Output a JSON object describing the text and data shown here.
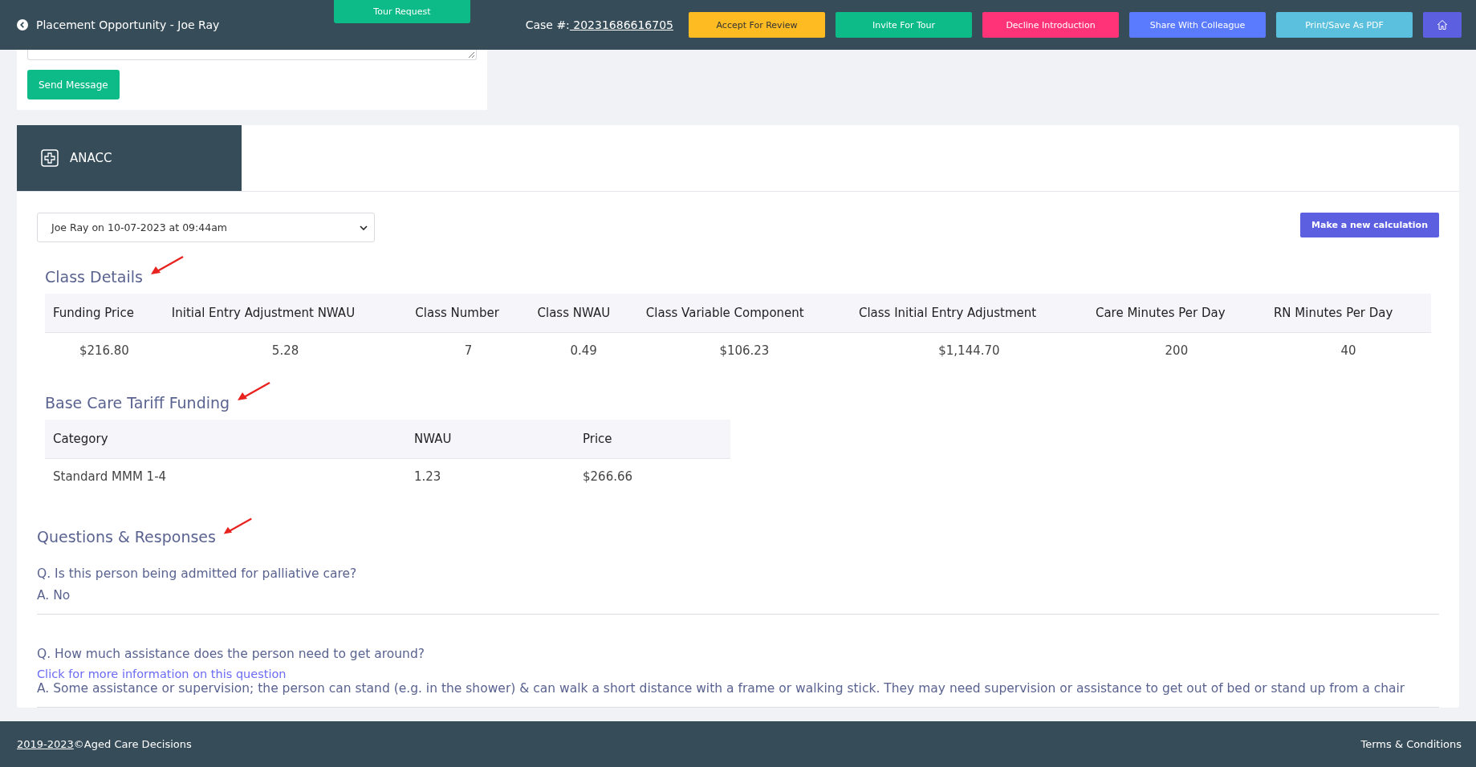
{
  "header": {
    "title": "Placement Opportunity - Joe Ray",
    "tour_request": "Tour Request",
    "case_label": "Case #:",
    "case_number": " 20231686616705",
    "actions": [
      {
        "label": "Accept For Review",
        "kind": "warning"
      },
      {
        "label": "Invite For Tour",
        "kind": "success"
      },
      {
        "label": "Decline Introduction",
        "kind": "danger"
      },
      {
        "label": "Share With Colleague",
        "kind": "primary"
      },
      {
        "label": "Print/Save As PDF",
        "kind": "info"
      },
      {
        "kind": "home"
      }
    ]
  },
  "message": {
    "send_button": "Send Message"
  },
  "anacc": {
    "tab": "ANACC",
    "assessment_select": "Joe Ray on 10-07-2023 at 09:44am",
    "new_calc_button": "Make a new calculation",
    "class_details": {
      "title": "Class Details",
      "marked": true,
      "columns": [
        "Funding Price",
        "Initial Entry Adjustment NWAU",
        "Class Number",
        "Class NWAU",
        "Class Variable Component",
        "Class Initial Entry Adjustment",
        "Care Minutes Per Day",
        "RN Minutes Per Day"
      ],
      "rows": [
        [
          "$216.80",
          "5.28",
          "7",
          "0.49",
          "$106.23",
          "$1,144.70",
          "200",
          "40"
        ]
      ]
    },
    "base_care": {
      "title": "Base Care Tariff Funding",
      "marked": true,
      "columns": [
        "Category",
        "NWAU",
        "Price"
      ],
      "rows": [
        [
          "Standard MMM 1-4",
          "1.23",
          "$266.66"
        ]
      ]
    },
    "questions": {
      "title": "Questions & Responses",
      "marked": true,
      "items": [
        {
          "question": "Q. Is this person being admitted for palliative care?",
          "answer": "A. No"
        },
        {
          "question": "Q. How much assistance does the person need to get around?",
          "info_link": "Click for more information on this question",
          "answer": "A. Some assistance or supervision; the person can stand (e.g. in the shower) & can walk a short distance with a frame or walking stick. They may need supervision or assistance to get out of bed or stand up from a chair"
        }
      ]
    }
  },
  "footer": {
    "years": "2019-2023",
    "copyright": "©Aged Care Decisions",
    "terms": "Terms & Conditions"
  }
}
